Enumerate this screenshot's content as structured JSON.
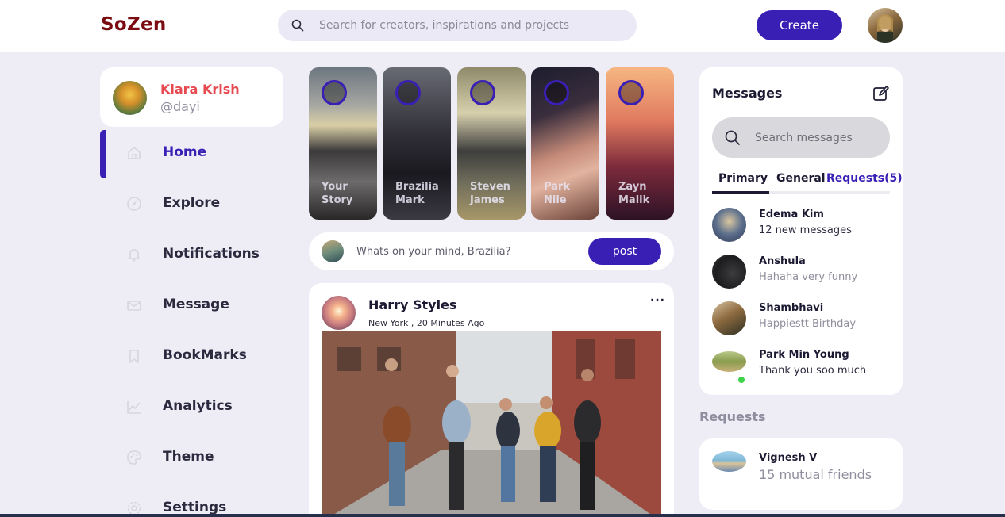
{
  "navbar": {
    "logo": "SoZen",
    "search_placeholder": "Search for creators, inspirations and projects",
    "create_label": "Create",
    "avatar_icon": "user-avatar"
  },
  "profile": {
    "name": "Klara Krish",
    "handle": "@dayi"
  },
  "sidebar": {
    "items": [
      {
        "label": "Home",
        "icon": "home-icon",
        "active": true
      },
      {
        "label": "Explore",
        "icon": "compass-icon",
        "active": false
      },
      {
        "label": "Notifications",
        "icon": "bell-icon",
        "active": false
      },
      {
        "label": "Message",
        "icon": "mail-icon",
        "active": false
      },
      {
        "label": "BookMarks",
        "icon": "bookmark-icon",
        "active": false
      },
      {
        "label": "Analytics",
        "icon": "chart-icon",
        "active": false
      },
      {
        "label": "Theme",
        "icon": "palette-icon",
        "active": false
      },
      {
        "label": "Settings",
        "icon": "gear-icon",
        "active": false
      }
    ]
  },
  "stories": [
    {
      "name": "Your Story"
    },
    {
      "name": "Brazilia Mark"
    },
    {
      "name": "Steven James"
    },
    {
      "name": "Park Nile"
    },
    {
      "name": "Zayn Malik"
    }
  ],
  "composer": {
    "placeholder": "Whats on your mind, Brazilia?",
    "post_label": "post"
  },
  "feed": {
    "author": "Harry Styles",
    "meta": "New York , 20 Minutes Ago",
    "more": "···"
  },
  "messages": {
    "title": "Messages",
    "search_placeholder": "Search messages",
    "tabs": {
      "primary": "Primary",
      "general": "General",
      "requests": "Requests(5)"
    },
    "items": [
      {
        "name": "Edema Kim",
        "text": "12 new messages"
      },
      {
        "name": "Anshula",
        "text": "Hahaha very funny"
      },
      {
        "name": "Shambhavi",
        "text": "Happiestt Birthday"
      },
      {
        "name": "Park Min Young",
        "text": "Thank you soo much"
      }
    ]
  },
  "requests": {
    "heading": "Requests",
    "name": "Vignesh V",
    "mutual": "15 mutual friends"
  },
  "colors": {
    "accent": "#3a1fb5",
    "logo": "#7a0c12",
    "profile_name": "#e64a50",
    "background": "#eeedf6"
  }
}
